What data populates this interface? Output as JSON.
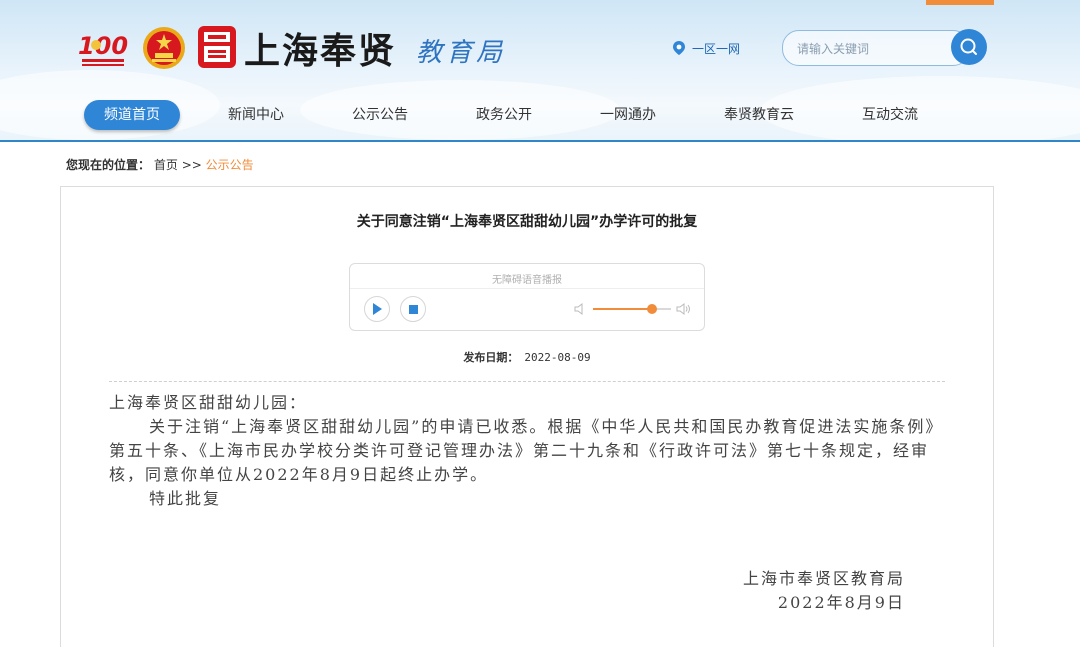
{
  "header": {
    "site_name": "上海奉贤",
    "bureau_name": "教育局",
    "region_link": "一区一网",
    "search_placeholder": "请输入关键词",
    "accent_color": "#2f86d6"
  },
  "nav": {
    "items": [
      {
        "label": "频道首页",
        "active": true
      },
      {
        "label": "新闻中心"
      },
      {
        "label": "公示公告"
      },
      {
        "label": "政务公开"
      },
      {
        "label": "一网通办"
      },
      {
        "label": "奉贤教育云"
      },
      {
        "label": "互动交流"
      }
    ]
  },
  "breadcrumb": {
    "label": "您现在的位置：",
    "home": "首页",
    "separator": ">>",
    "current": "公示公告"
  },
  "article": {
    "title": "关于同意注销“上海奉贤区甜甜幼儿园”办学许可的批复",
    "player": {
      "label": "无障碍语音播报",
      "volume": 0.75
    },
    "date_label": "发布日期：",
    "date": "2022-08-09",
    "salutation": "上海奉贤区甜甜幼儿园：",
    "body": "关于注销“上海奉贤区甜甜幼儿园”的申请已收悉。根据《中华人民共和国民办教育促进法实施条例》第五十条、《上海市民办学校分类许可登记管理办法》第二十九条和《行政许可法》第七十条规定，经审核，同意你单位从2022年8月9日起终止办学。",
    "closing": "特此批复",
    "signature_org": "上海市奉贤区教育局",
    "signature_date": "2022年8月9日"
  }
}
